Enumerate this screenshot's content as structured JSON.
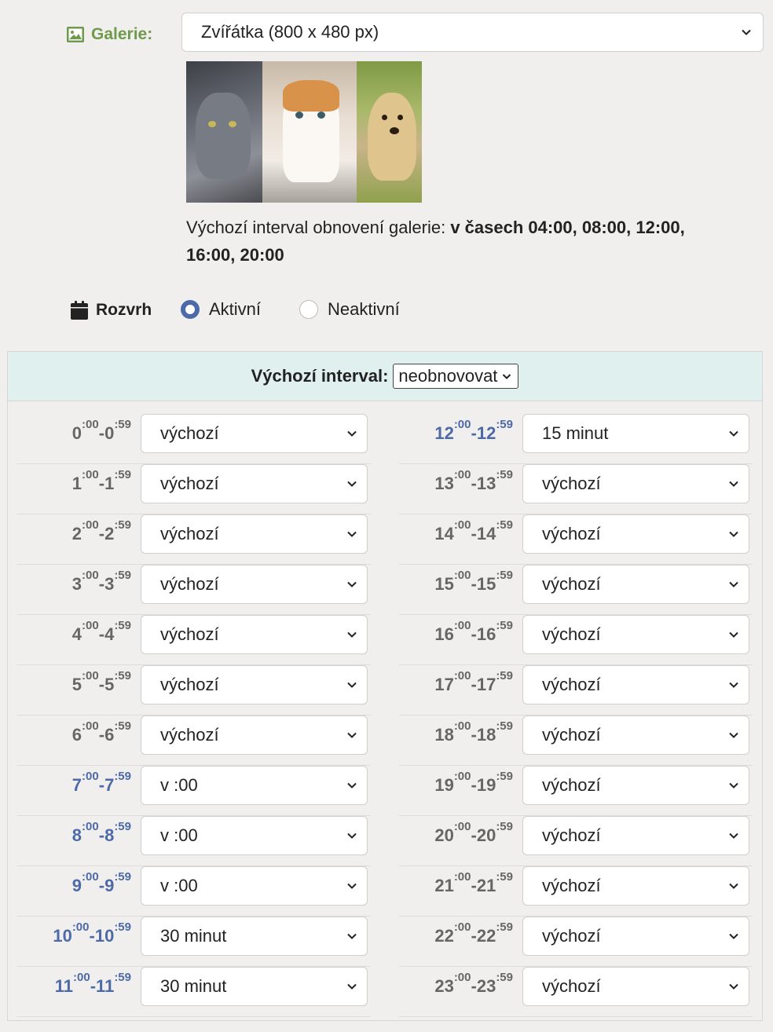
{
  "gallery": {
    "label": "Galerie:",
    "selected": "Zvířátka (800 x 480 px)",
    "info_prefix": "Výchozí interval obnovení galerie: ",
    "info_bold": "v časech 04:00, 08:00, 12:00, 16:00, 20:00"
  },
  "schedule": {
    "label": "Rozvrh",
    "radio_active": "Aktivní",
    "radio_inactive": "Neaktivní",
    "selected_radio": "Aktivní",
    "default_label": "Výchozí interval:",
    "default_value": "neobnovovat"
  },
  "hours": [
    {
      "from": "0",
      "to": "0",
      "sf": ":00",
      "st": ":59",
      "value": "výchozí"
    },
    {
      "from": "1",
      "to": "1",
      "sf": ":00",
      "st": ":59",
      "value": "výchozí"
    },
    {
      "from": "2",
      "to": "2",
      "sf": ":00",
      "st": ":59",
      "value": "výchozí"
    },
    {
      "from": "3",
      "to": "3",
      "sf": ":00",
      "st": ":59",
      "value": "výchozí"
    },
    {
      "from": "4",
      "to": "4",
      "sf": ":00",
      "st": ":59",
      "value": "výchozí"
    },
    {
      "from": "5",
      "to": "5",
      "sf": ":00",
      "st": ":59",
      "value": "výchozí"
    },
    {
      "from": "6",
      "to": "6",
      "sf": ":00",
      "st": ":59",
      "value": "výchozí"
    },
    {
      "from": "7",
      "to": "7",
      "sf": ":00",
      "st": ":59",
      "value": "v :00"
    },
    {
      "from": "8",
      "to": "8",
      "sf": ":00",
      "st": ":59",
      "value": "v :00"
    },
    {
      "from": "9",
      "to": "9",
      "sf": ":00",
      "st": ":59",
      "value": "v :00"
    },
    {
      "from": "10",
      "to": "10",
      "sf": ":00",
      "st": ":59",
      "value": "30 minut"
    },
    {
      "from": "11",
      "to": "11",
      "sf": ":00",
      "st": ":59",
      "value": "30 minut"
    },
    {
      "from": "12",
      "to": "12",
      "sf": ":00",
      "st": ":59",
      "value": "15 minut"
    },
    {
      "from": "13",
      "to": "13",
      "sf": ":00",
      "st": ":59",
      "value": "výchozí"
    },
    {
      "from": "14",
      "to": "14",
      "sf": ":00",
      "st": ":59",
      "value": "výchozí"
    },
    {
      "from": "15",
      "to": "15",
      "sf": ":00",
      "st": ":59",
      "value": "výchozí"
    },
    {
      "from": "16",
      "to": "16",
      "sf": ":00",
      "st": ":59",
      "value": "výchozí"
    },
    {
      "from": "17",
      "to": "17",
      "sf": ":00",
      "st": ":59",
      "value": "výchozí"
    },
    {
      "from": "18",
      "to": "18",
      "sf": ":00",
      "st": ":59",
      "value": "výchozí"
    },
    {
      "from": "19",
      "to": "19",
      "sf": ":00",
      "st": ":59",
      "value": "výchozí"
    },
    {
      "from": "20",
      "to": "20",
      "sf": ":00",
      "st": ":59",
      "value": "výchozí"
    },
    {
      "from": "21",
      "to": "21",
      "sf": ":00",
      "st": ":59",
      "value": "výchozí"
    },
    {
      "from": "22",
      "to": "22",
      "sf": ":00",
      "st": ":59",
      "value": "výchozí"
    },
    {
      "from": "23",
      "to": "23",
      "sf": ":00",
      "st": ":59",
      "value": "výchozí"
    }
  ],
  "colors": {
    "gallery_label": "#6f9a4c",
    "hour_default": "#666666",
    "hour_custom": "#4d6aa8",
    "radio_accent": "#4d6aa8",
    "header_bg": "#dff0ef"
  },
  "icons": {
    "gallery": "image-icon",
    "schedule": "calendar-icon",
    "select": "chevron-down-icon"
  }
}
